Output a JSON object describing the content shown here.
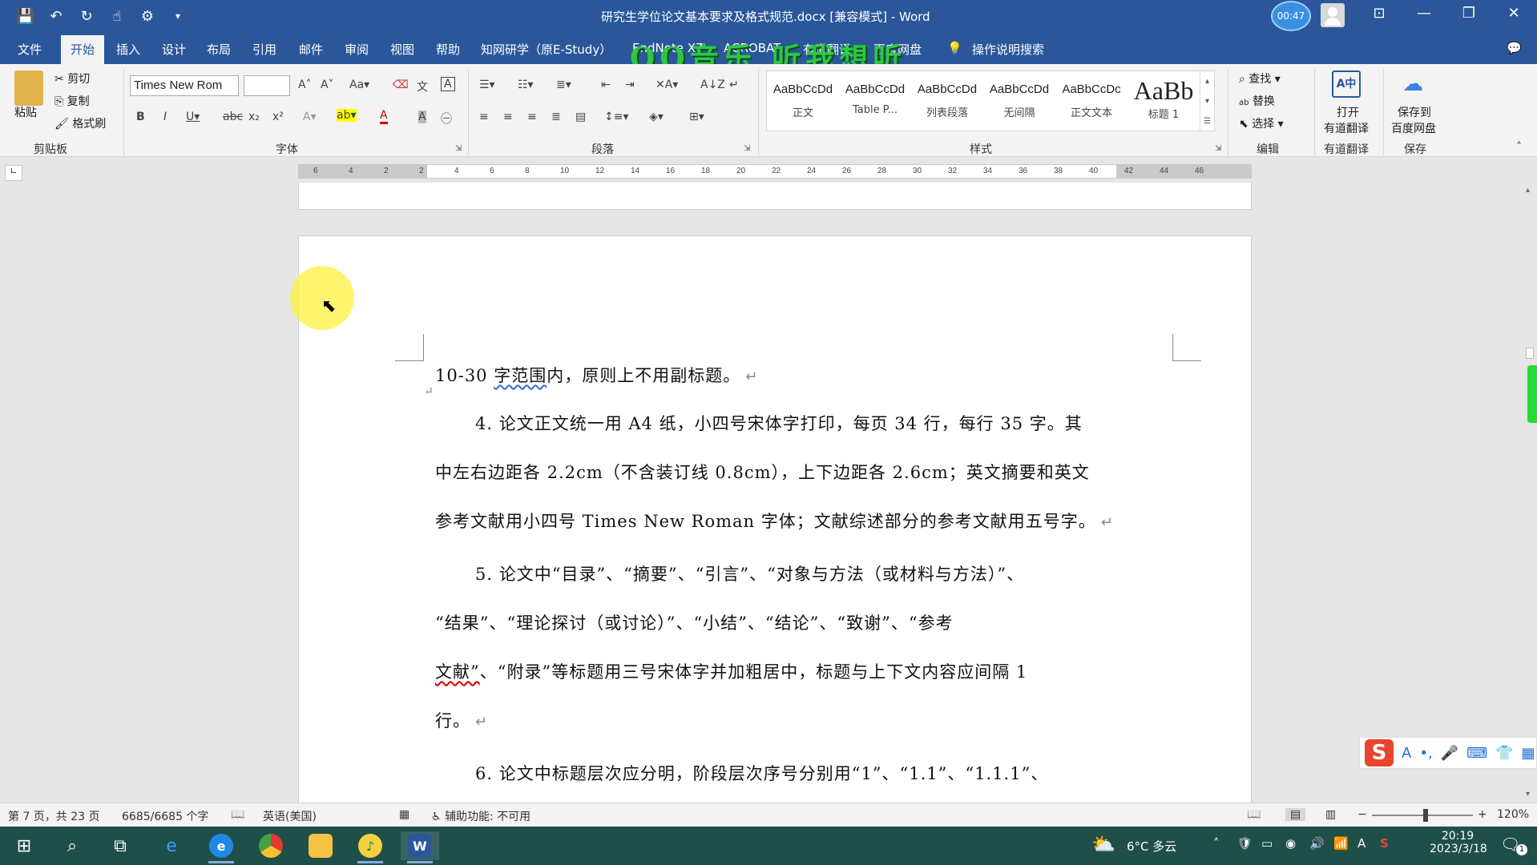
{
  "titlebar": {
    "title": "研究生学位论文基本要求及格式规范.docx [兼容模式] - Word",
    "timer": "00:47"
  },
  "menu": {
    "tabs": [
      "文件",
      "开始",
      "插入",
      "设计",
      "布局",
      "引用",
      "邮件",
      "审阅",
      "视图",
      "帮助",
      "知网研学（原E-Study）",
      "EndNote X7",
      "ACROBAT",
      "有道翻译",
      "百度网盘"
    ],
    "active_tab": "开始",
    "search_label": "操作说明搜索",
    "watermark": "QQ音乐 听我想听"
  },
  "ribbon": {
    "clipboard": {
      "label": "剪贴板",
      "paste": "粘贴",
      "cut": "剪切",
      "copy": "复制",
      "format_painter": "格式刷"
    },
    "font": {
      "label": "字体",
      "font_name": "Times New Rom",
      "font_size": ""
    },
    "paragraph": {
      "label": "段落"
    },
    "styles": {
      "label": "样式",
      "items": [
        {
          "preview": "AaBbCcDd",
          "name": "正文"
        },
        {
          "preview": "AaBbCcDd",
          "name": "Table P..."
        },
        {
          "preview": "AaBbCcDd",
          "name": "列表段落"
        },
        {
          "preview": "AaBbCcDd",
          "name": "无间隔"
        },
        {
          "preview": "AaBbCcDc",
          "name": "正文文本"
        },
        {
          "preview": "AaBb",
          "name": "标题 1"
        }
      ]
    },
    "editing": {
      "label": "编辑",
      "find": "查找",
      "replace": "替换",
      "select": "选择"
    },
    "youdao": {
      "label": "有道翻译",
      "open_line1": "打开",
      "open_line2": "有道翻译"
    },
    "save": {
      "label": "保存",
      "line1": "保存到",
      "line2": "百度网盘"
    }
  },
  "ruler": {
    "numbers": [
      "6",
      "4",
      "2",
      "2",
      "4",
      "6",
      "8",
      "10",
      "12",
      "14",
      "16",
      "18",
      "20",
      "22",
      "24",
      "26",
      "28",
      "30",
      "32",
      "34",
      "36",
      "38",
      "40",
      "42",
      "44",
      "46"
    ]
  },
  "document": {
    "line1_pre": "10-30 ",
    "line1_squig": "字范围",
    "line1_post": "内，原则上不用副标题。",
    "p4_line1": "4. 论文正文统一用 A4 纸，小四号宋体字打印，每页 34 行，每行 35 字。其",
    "p4_line2": "中左右边距各 2.2cm（不含装订线 0.8cm），上下边距各 2.6cm；英文摘要和英文",
    "p4_line3": "参考文献用小四号 Times New Roman 字体；文献综述部分的参考文献用五号字。",
    "p5_line1": "5. 论文中“目录”、“摘要”、“引言”、“对象与方法（或材料与方法）”、",
    "p5_line2": "“结果”、“理论探讨（或讨论）”、“小结”、“结论”、“致谢”、“参考",
    "p5_line3_squig": "文献”",
    "p5_line3_post": "、“附录”等标题用三号宋体字并加粗居中，标题与上下文内容应间隔 1",
    "p5_line4": "行。",
    "p6_line1": "6. 论文中标题层次应分明，阶段层次序号分别用“1”、“1.1”、“1.1.1”、"
  },
  "statusbar": {
    "page": "第 7 页，共 23 页",
    "words": "6685/6685 个字",
    "language": "英语(美国)",
    "accessibility": "辅助功能: 不可用",
    "zoom": "120%"
  },
  "taskbar": {
    "weather": "6°C  多云",
    "time": "20:19",
    "date": "2023/3/18",
    "notification_count": "1"
  }
}
